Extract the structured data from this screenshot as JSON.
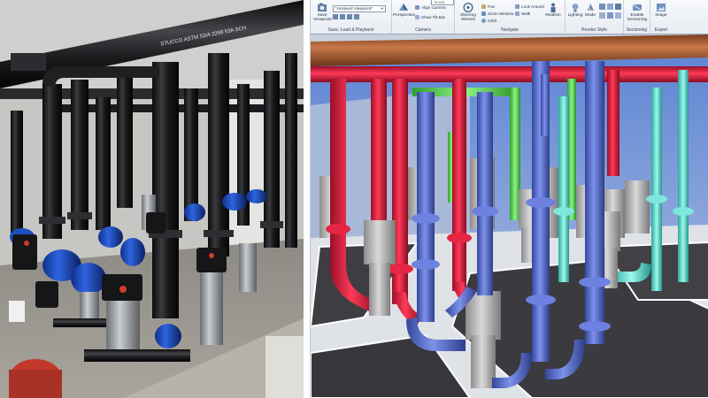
{
  "ribbon": {
    "viewpoint_dropdown": "*Unsaved Viewpoint*",
    "save_viewpoint": "Save Viewpoint",
    "perspective": "Perspective",
    "align_camera": "Align Camera",
    "fov_value": "75.375",
    "show_tilt_bar": "Show Tilt Bar",
    "steering_wheels": "Steering Wheels",
    "pan": "Pan",
    "zoom_window": "Zoom Window",
    "orbit": "Orbit",
    "look_around": "Look Around",
    "walk": "Walk",
    "realism": "Realism",
    "lighting": "Lighting",
    "mode": "Mode",
    "enable_sectioning": "Enable Sectioning",
    "image": "Image",
    "groups": {
      "save_load_playback": "Save, Load & Playback",
      "camera": "Camera",
      "navigate": "Navigate",
      "render_style": "Render Style",
      "sectioning": "Sectioning",
      "export": "Export"
    }
  },
  "colors": {
    "blue_pipe": "#5c73d6",
    "red_pipe": "#e8193d",
    "green_pipe": "#66e25e",
    "cyan_pipe": "#66e6d8",
    "copper_pipe": "#b5653a",
    "pump_gray": "#b9b9b9"
  }
}
